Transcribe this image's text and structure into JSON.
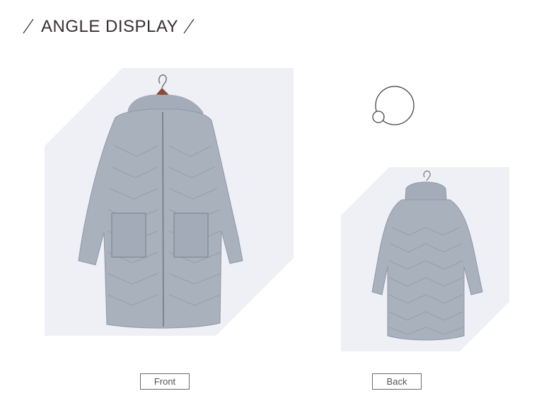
{
  "header": {
    "title": "ANGLE DISPLAY"
  },
  "views": {
    "front": {
      "label": "Front"
    },
    "back": {
      "label": "Back"
    }
  },
  "colors": {
    "title": "#3a2f33",
    "panel_bg": "#eef0f6",
    "coat": "#a9b1bd",
    "coat_dark": "#8f98a6",
    "hanger": "#8a4b3e"
  },
  "icons": {
    "rotate": "rotate-360-icon"
  }
}
